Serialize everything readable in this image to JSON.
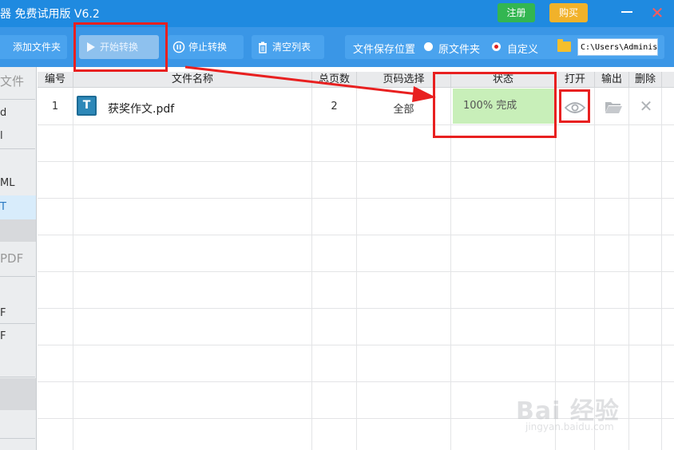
{
  "window": {
    "title": "器 免费试用版 V6.2",
    "register_label": "注册",
    "buy_label": "购买",
    "minimize_icon": "minimize-icon",
    "close_icon": "close-icon"
  },
  "toolbar": {
    "add_folder_label": "添加文件夹",
    "start_label": "开始转换",
    "stop_label": "停止转换",
    "clear_label": "清空列表",
    "save_location_label": "文件保存位置",
    "option_original_label": "原文件夹",
    "option_custom_label": "自定义",
    "selected_option": "自定义",
    "path_value": "C:\\Users\\Adminis"
  },
  "sidebar": {
    "items": [
      "文件",
      "d",
      "l",
      "ML",
      "T",
      "PDF",
      "F",
      "F"
    ],
    "active_item": "T"
  },
  "table": {
    "columns": [
      "编号",
      "文件名称",
      "总页数",
      "页码选择",
      "状态",
      "打开",
      "输出",
      "删除"
    ],
    "rows": [
      {
        "index": "1",
        "file_name": "获奖作文.pdf",
        "pages": "2",
        "page_selection": "全部",
        "status": "100% 完成",
        "progress": 1.0
      }
    ]
  },
  "watermark": {
    "text": "Bai 经验",
    "sub": "jingyan.baidu.com"
  },
  "colors": {
    "titlebar": "#1f8ae0",
    "toolbar": "#3a96e6",
    "register": "#33b651",
    "buy": "#f1b22a",
    "status_done": "#c8efb9",
    "annotation": "#e82020"
  }
}
